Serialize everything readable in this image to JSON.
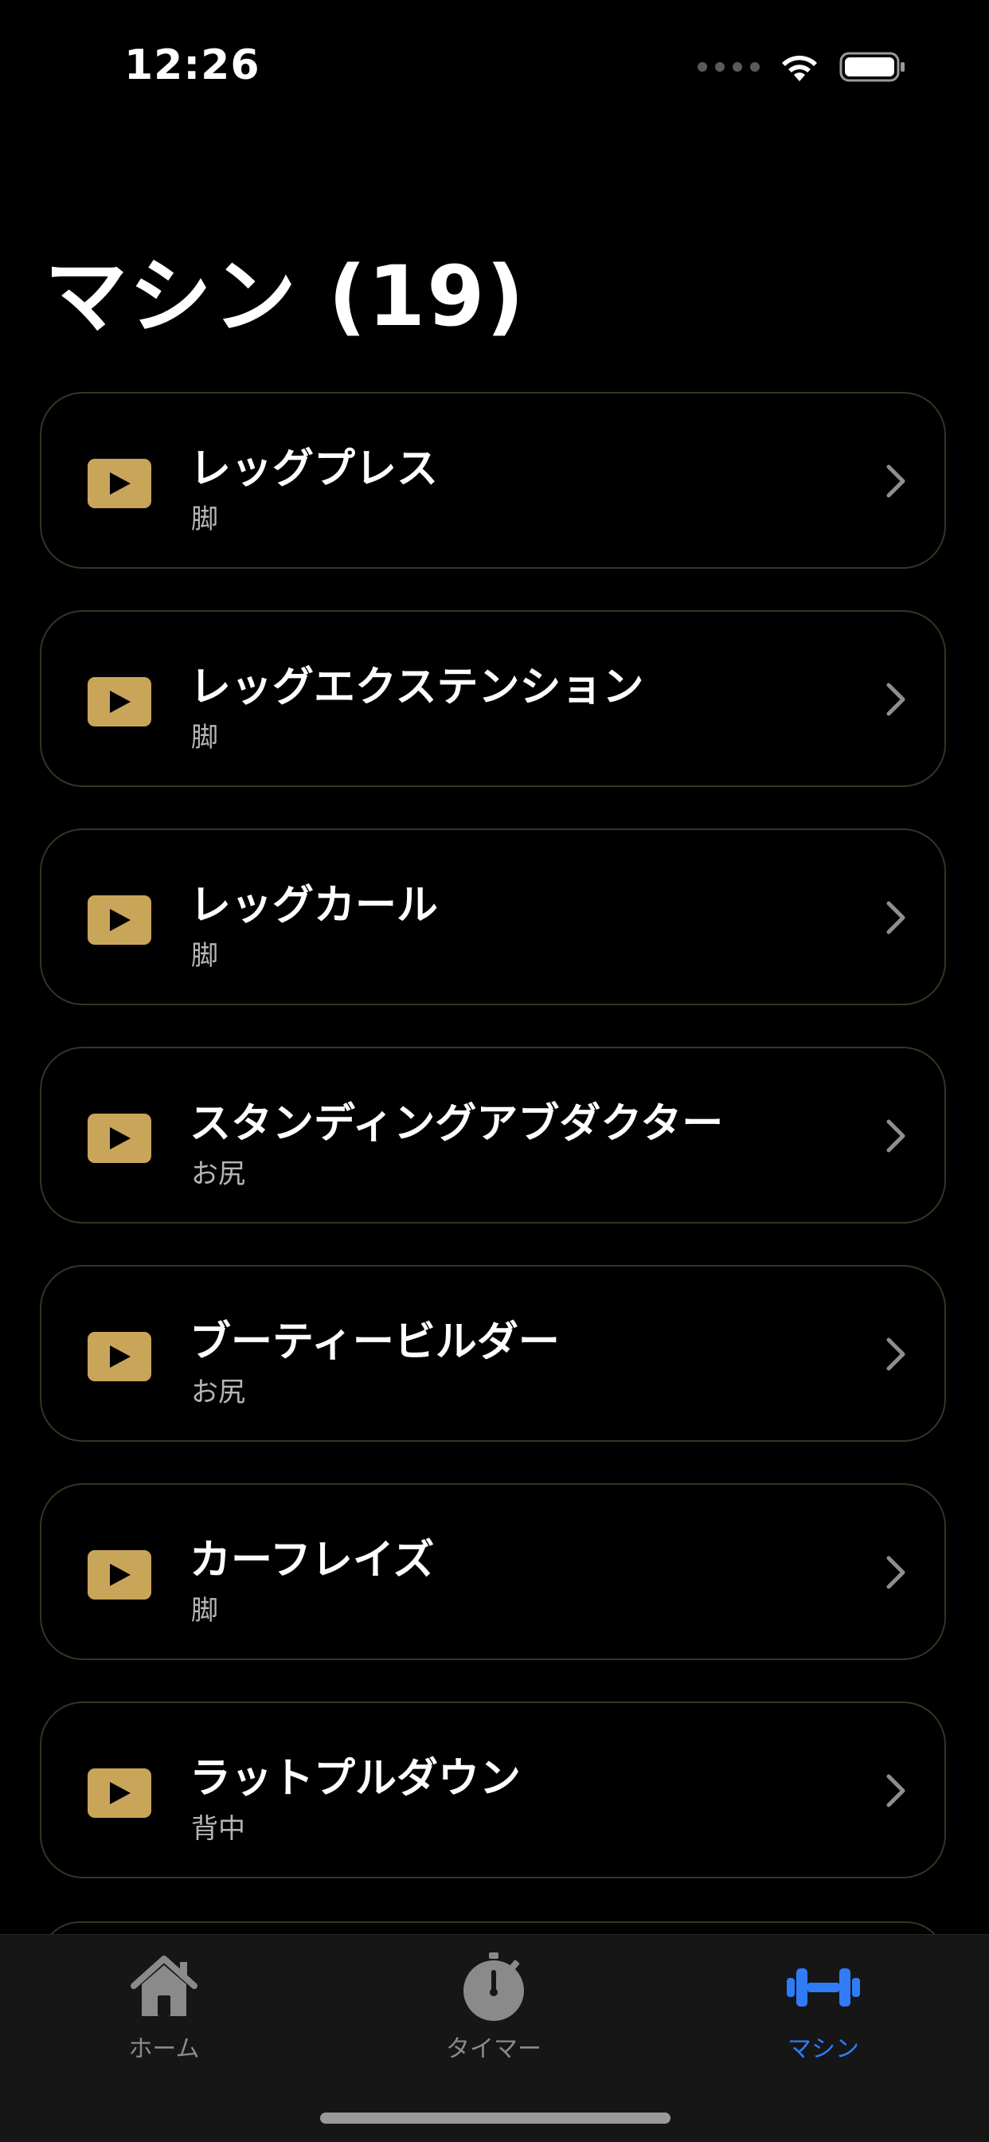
{
  "status_bar": {
    "time": "12:26"
  },
  "page": {
    "title": "マシン (19)"
  },
  "machines": [
    {
      "name": "レッグプレス",
      "category": "脚"
    },
    {
      "name": "レッグエクステンション",
      "category": "脚"
    },
    {
      "name": "レッグカール",
      "category": "脚"
    },
    {
      "name": "スタンディングアブダクター",
      "category": "お尻"
    },
    {
      "name": "ブーティービルダー",
      "category": "お尻"
    },
    {
      "name": "カーフレイズ",
      "category": "脚"
    },
    {
      "name": "ラットプルダウン",
      "category": "背中"
    }
  ],
  "tab_bar": {
    "home_label": "ホーム",
    "timer_label": "タイマー",
    "machine_label": "マシン",
    "active_tab": "machine"
  },
  "colors": {
    "accent_gold": "#c9a55a",
    "active_tab_blue": "#2f7cf6",
    "card_border": "#3a3224",
    "background": "#000000"
  },
  "icons": {
    "thumbnail": "play-icon",
    "row_action": "chevron-right-icon",
    "home_tab": "home-icon",
    "timer_tab": "stopwatch-icon",
    "machine_tab": "dumbbell-icon"
  }
}
